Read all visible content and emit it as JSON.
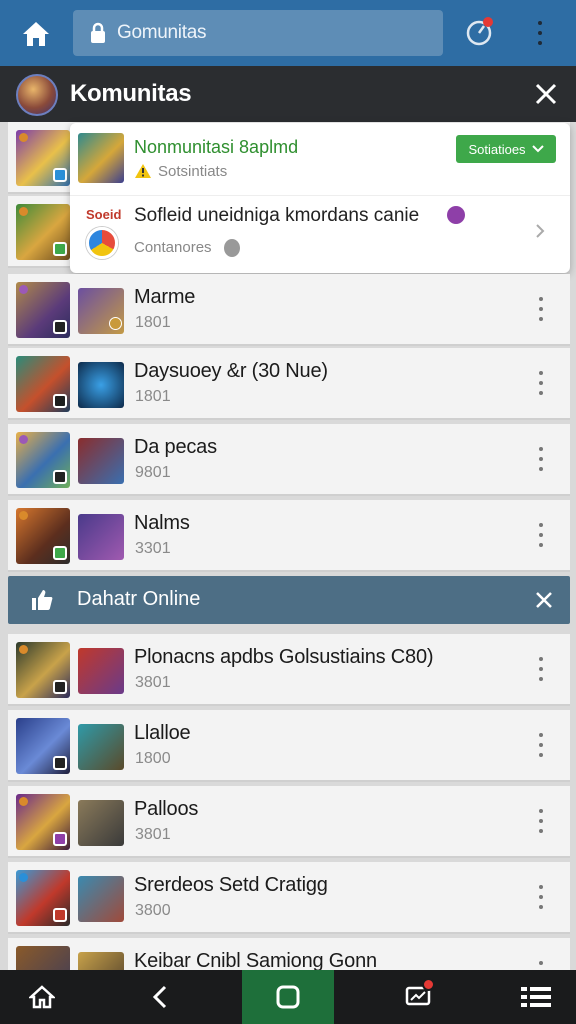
{
  "browser": {
    "url_text": "Gomunitas"
  },
  "header": {
    "title": "Komunitas"
  },
  "popup": {
    "title": "Nonmunitasi 8aplmd",
    "subtitle": "Sotsintiats",
    "button_label": "Sotiatioes",
    "label": "Soeid",
    "message": "Sofleid uneidniga kmordans canie",
    "message_sub": "Contanores"
  },
  "rows_top": [
    {
      "name": "Marme",
      "sub": "1801"
    },
    {
      "name": "Daysuoey &r (30 Nue)",
      "sub": "1801"
    },
    {
      "name": "Da pecas",
      "sub": "9801"
    },
    {
      "name": "Nalms",
      "sub": "3301"
    }
  ],
  "banner": {
    "title": "Dahatr Online"
  },
  "rows_bottom": [
    {
      "name": "Plonacns apdbs Golsustiains C80)",
      "sub": "3801"
    },
    {
      "name": "Llalloe",
      "sub": "1800"
    },
    {
      "name": "Palloos",
      "sub": "3801"
    },
    {
      "name": "Srerdeos Setd Cratigg",
      "sub": "3800"
    },
    {
      "name": "Keibar Cnibl Samiong Gonn",
      "sub": ""
    }
  ],
  "colors": {
    "topbar": "#2e6da4",
    "header": "#2b2d30",
    "accent_green": "#3ea84a",
    "banner": "#4d6e85"
  },
  "icons": [
    "home-icon",
    "lock-icon",
    "compass-icon",
    "more-vertical-icon",
    "close-icon",
    "thumbs-up-icon",
    "back-icon",
    "square-icon",
    "chat-icon",
    "menu-icon"
  ]
}
